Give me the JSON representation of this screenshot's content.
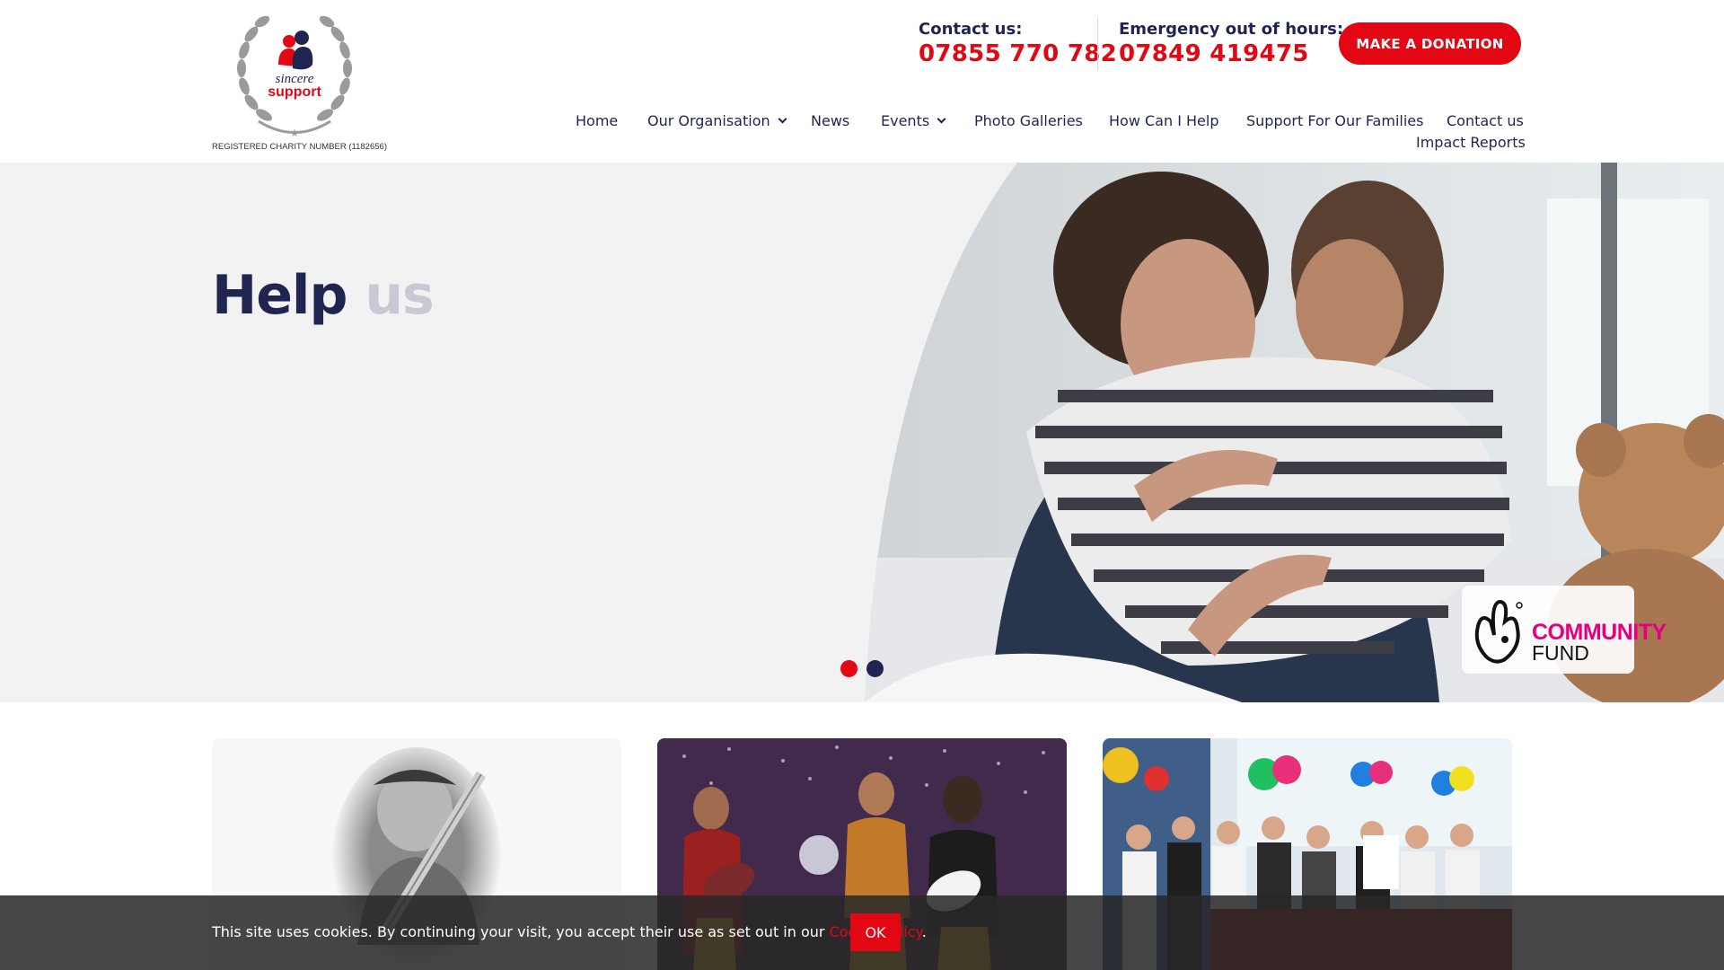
{
  "logo": {
    "text_line1": "sincere",
    "text_line2": "support",
    "charity_number": "REGISTERED CHARITY NUMBER (1182656)"
  },
  "contact": {
    "label": "Contact us:",
    "phone": "07855 770 782"
  },
  "emergency": {
    "label": "Emergency out of hours:",
    "phone": "07849 419475"
  },
  "donate_label": "MAKE A DONATION",
  "nav": {
    "home": "Home",
    "our_organisation": "Our Organisation",
    "news": "News",
    "events": "Events",
    "photo_galleries": "Photo Galleries",
    "how_can_i_help": "How Can I Help",
    "support_families": "Support For Our Families",
    "contact_us": "Contact us",
    "impact_reports": "Impact Reports"
  },
  "hero": {
    "title_word1": "Help",
    "title_word2": "us",
    "slides": 2,
    "active_slide": 1
  },
  "community_fund": {
    "line1": "COMMUNITY",
    "line2": "FUND"
  },
  "cookie": {
    "text": "This site uses cookies. By continuing your visit, you accept their use as set out in our ",
    "link": "Cookie Policy",
    "after": ".",
    "ok": "OK"
  },
  "colors": {
    "brand_navy": "#1f2550",
    "brand_red": "#e30613",
    "hero_bg": "#f2f2f3",
    "community_pink": "#e6007e"
  }
}
